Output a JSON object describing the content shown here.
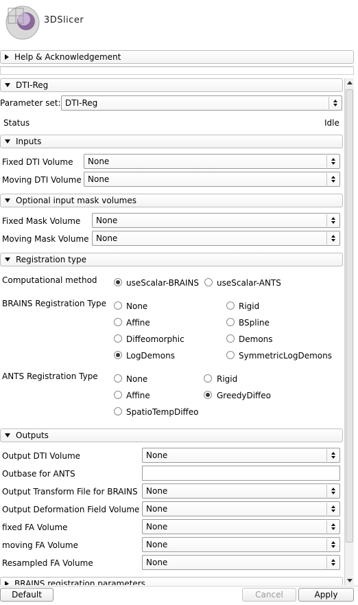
{
  "app": {
    "logo_text": "3DSlicer"
  },
  "help": {
    "label": "Help & Acknowledgement"
  },
  "module": {
    "title": "DTI-Reg"
  },
  "param_set": {
    "label": "Parameter set:",
    "value": "DTI-Reg"
  },
  "status": {
    "label": "Status",
    "value": "Idle"
  },
  "inputs": {
    "header": "Inputs",
    "fixed_label": "Fixed DTI Volume",
    "fixed_value": "None",
    "moving_label": "Moving DTI Volume",
    "moving_value": "None"
  },
  "masks": {
    "header": "Optional input mask volumes",
    "fixed_label": "Fixed Mask Volume",
    "fixed_value": "None",
    "moving_label": "Moving Mask Volume",
    "moving_value": "None"
  },
  "registration": {
    "header": "Registration type",
    "method_label": "Computational method",
    "method_options": [
      "useScalar-BRAINS",
      "useScalar-ANTS"
    ],
    "brains_label": "BRAINS Registration Type",
    "brains_options": [
      "None",
      "Rigid",
      "Affine",
      "BSpline",
      "Diffeomorphic",
      "Demons",
      "LogDemons",
      "SymmetricLogDemons"
    ],
    "ants_label": "ANTS Registration Type",
    "ants_options": [
      "None",
      "Rigid",
      "Affine",
      "GreedyDiffeo",
      "SpatioTempDiffeo"
    ]
  },
  "outputs": {
    "header": "Outputs",
    "dti_label": "Output DTI Volume",
    "dti_value": "None",
    "outbase_label": "Outbase for ANTS",
    "outbase_value": "",
    "transform_label": "Output Transform File for BRAINS",
    "transform_value": "None",
    "deform_label": "Output Deformation Field Volume",
    "deform_value": "None",
    "fixed_fa_label": "fixed FA Volume",
    "fixed_fa_value": "None",
    "moving_fa_label": "moving FA Volume",
    "moving_fa_value": "None",
    "resampled_fa_label": "Resampled FA Volume",
    "resampled_fa_value": "None"
  },
  "brains_params": {
    "header": "BRAINS registration parameters"
  },
  "footer": {
    "default": "Default",
    "cancel": "Cancel",
    "apply": "Apply"
  }
}
